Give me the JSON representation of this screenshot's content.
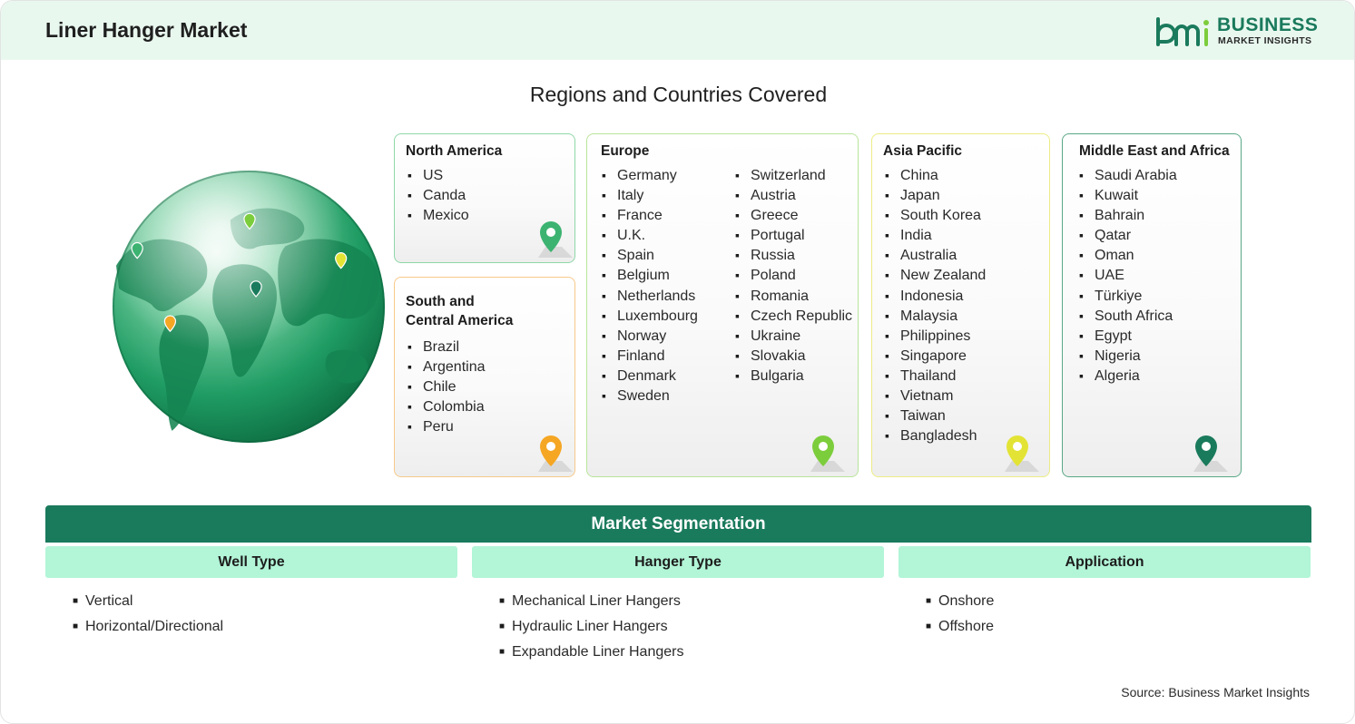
{
  "header": {
    "title": "Liner Hanger Market",
    "logo": {
      "line1": "BUSINESS",
      "line2": "MARKET INSIGHTS",
      "mark_text": "bmi"
    }
  },
  "regions_title": "Regions and Countries Covered",
  "regions": {
    "north_america": {
      "title": "North America",
      "countries": [
        "US",
        "Canda",
        "Mexico"
      ],
      "color": "#3cb371"
    },
    "south_central_america": {
      "title_line1": "South and",
      "title_line2": "Central America",
      "countries": [
        "Brazil",
        "Argentina",
        "Chile",
        "Colombia",
        "Peru"
      ],
      "color": "#f5a623"
    },
    "europe": {
      "title": "Europe",
      "countries_col1": [
        "Germany",
        "Italy",
        "France",
        "U.K.",
        "Spain",
        "Belgium",
        "Netherlands",
        "Luxembourg",
        "Norway",
        "Finland",
        "Denmark",
        "Sweden"
      ],
      "countries_col2": [
        "Switzerland",
        "Austria",
        "Greece",
        "Portugal",
        "Russia",
        "Poland",
        "Romania",
        "Czech Republic",
        "Ukraine",
        "Slovakia",
        "Bulgaria"
      ],
      "color": "#7ccd3c"
    },
    "asia_pacific": {
      "title": "Asia Pacific",
      "countries": [
        "China",
        "Japan",
        "South Korea",
        "India",
        "Australia",
        "New Zealand",
        "Indonesia",
        "Malaysia",
        "Philippines",
        "Singapore",
        "Thailand",
        "Vietnam",
        "Taiwan",
        "Bangladesh"
      ],
      "color": "#e3e335"
    },
    "middle_east_africa": {
      "title": "Middle East and Africa",
      "countries": [
        "Saudi Arabia",
        "Kuwait",
        "Bahrain",
        "Qatar",
        "Oman",
        "UAE",
        "Türkiye",
        "South Africa",
        "Egypt",
        "Nigeria",
        "Algeria"
      ],
      "color": "#1a7a5c"
    }
  },
  "segmentation": {
    "title": "Market Segmentation",
    "columns": [
      {
        "heading": "Well Type",
        "items": [
          "Vertical",
          "Horizontal/Directional"
        ]
      },
      {
        "heading": "Hanger Type",
        "items": [
          "Mechanical Liner Hangers",
          "Hydraulic Liner Hangers",
          "Expandable Liner Hangers"
        ]
      },
      {
        "heading": "Application",
        "items": [
          "Onshore",
          "Offshore"
        ]
      }
    ]
  },
  "source": "Source: Business Market Insights",
  "colors": {
    "brand": "#1a7a5c",
    "header_bg": "#e9f8ef",
    "segment_head": "#b2f5d7"
  }
}
